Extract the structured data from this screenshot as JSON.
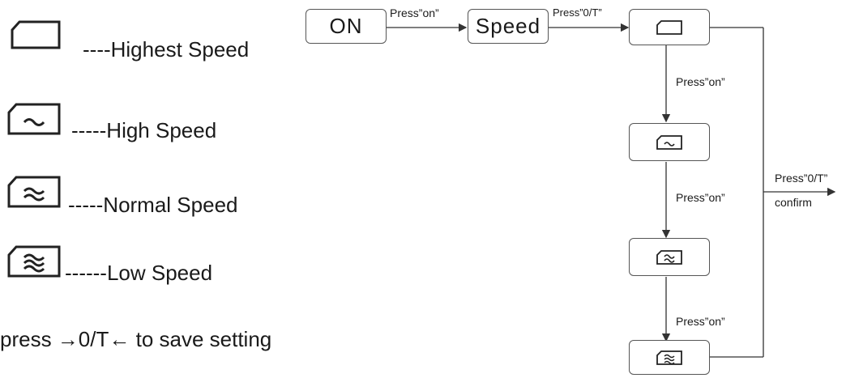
{
  "legend": {
    "items": [
      {
        "icon": "speed-level-0-icon",
        "text": "----Highest Speed"
      },
      {
        "icon": "speed-level-1-icon",
        "text": "-----High Speed"
      },
      {
        "icon": "speed-level-2-icon",
        "text": "-----Normal Speed"
      },
      {
        "icon": "speed-level-3-icon",
        "text": "------Low Speed"
      }
    ],
    "note": "press →0/T← to save setting"
  },
  "flow": {
    "on_box": "ON",
    "speed_box": "Speed",
    "label_press_on_top": "Press”on”",
    "label_press_0t_top": "Press”0/T”",
    "label_press_on_1": "Press”on”",
    "label_press_on_2": "Press”on”",
    "label_press_on_3": "Press”on”",
    "label_press_0t_right": "Press”0/T”",
    "label_confirm": "confirm"
  },
  "colors": {
    "line": "#333333",
    "box_border": "#555555",
    "text": "#1a1a1a"
  }
}
